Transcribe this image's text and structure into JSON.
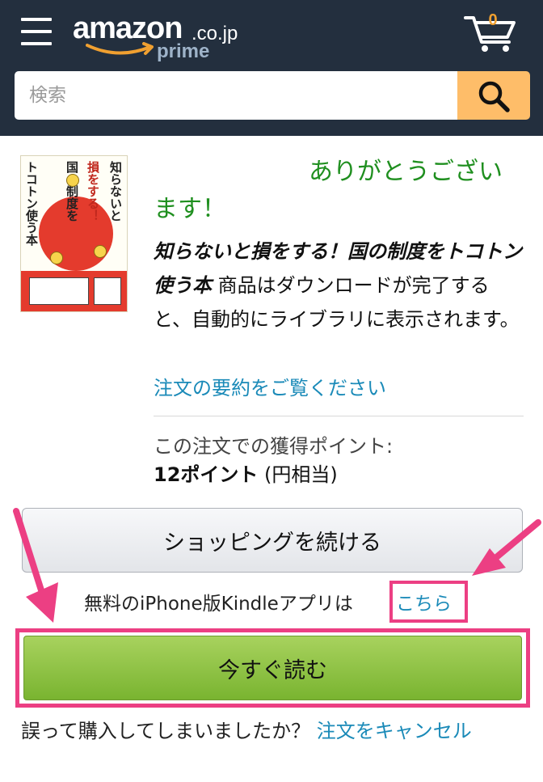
{
  "header": {
    "logo_main": "amazon",
    "logo_tld": ".co.jp",
    "logo_prime": "prime",
    "cart_count": "0",
    "menu_icon": "hamburger-menu-icon",
    "cart_icon": "cart-icon"
  },
  "search": {
    "placeholder": "検索",
    "button_icon": "search-icon"
  },
  "order": {
    "thanks": "ありがとうございます！",
    "book_title": "知らないと損をする！国の制度をトコトン使う本",
    "download_message": " 商品はダウンロードが完了すると、自動的にライブラリに表示されます。",
    "summary_link": "注文の要約をご覧ください",
    "points_label": "この注文での獲得ポイント:",
    "points_value": "12ポイント",
    "points_note": " (円相当)"
  },
  "cover": {
    "line1": "知らないと",
    "line2": "損をする！",
    "line3": "国の制度を",
    "line4": "トコトン使う本"
  },
  "actions": {
    "continue_shopping": "ショッピングを続ける",
    "kindle_text": "無料のiPhone版Kindleアプリは",
    "kindle_link": "こちら",
    "read_now": "今すぐ読む",
    "mistake_text": "誤って購入してしまいましたか？ ",
    "cancel_link": "注文をキャンセル"
  },
  "colors": {
    "header_bg": "#232f3e",
    "search_button": "#febd69",
    "thanks_green": "#1f8f1f",
    "link_blue": "#1a8ab8",
    "read_button": "#8bc34a",
    "highlight_pink": "#ec3f83"
  }
}
